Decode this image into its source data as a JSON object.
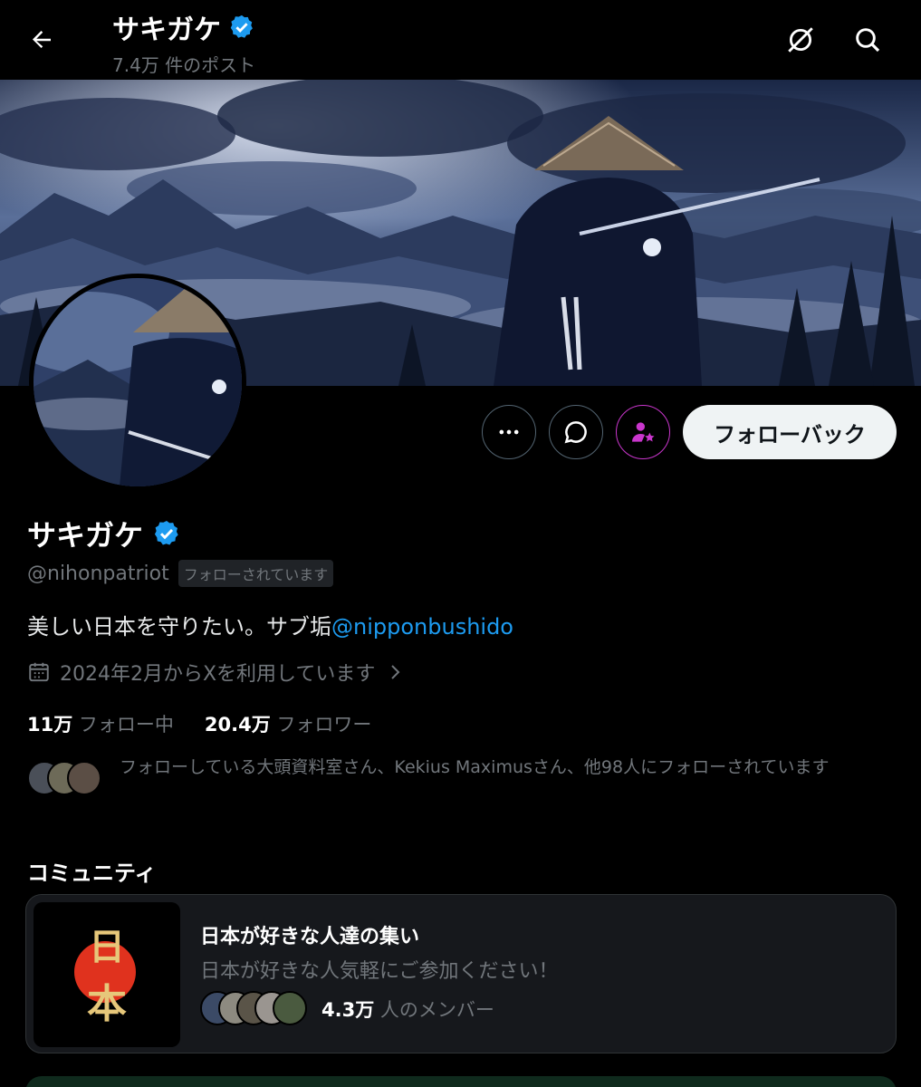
{
  "header": {
    "title": "サキガケ",
    "post_count": "7.4万 件のポスト"
  },
  "profile": {
    "name": "サキガケ",
    "handle": "@nihonpatriot",
    "follows_you_badge": "フォローされています",
    "bio_text": "美しい日本を守りたい。サブ垢",
    "bio_mention": "@nipponbushido",
    "joined": "2024年2月からXを利用しています",
    "following_count": "11万",
    "following_label": "フォロー中",
    "followers_count": "20.4万",
    "followers_label": "フォロワー",
    "followed_by_text": "フォローしている大頭資料室さん、Kekius Maximusさん、他98人にフォローされています"
  },
  "actions": {
    "follow_back_label": "フォローバック"
  },
  "community": {
    "section_title": "コミュニティ",
    "name": "日本が好きな人達の集い",
    "description": "日本が好きな人気軽にご参加ください！",
    "member_count": "4.3万",
    "member_label": "人のメンバー",
    "thumb_text_top": "日",
    "thumb_text_bottom": "本"
  },
  "colors": {
    "accent_blue": "#1d9bf0",
    "subscribe_purple": "#c936cc",
    "muted": "#71767b"
  },
  "icons": {
    "back": "arrow-left-icon",
    "grok": "grok-slash-icon",
    "search": "search-icon",
    "more": "more-dots-icon",
    "message": "message-bubble-icon",
    "subscribe": "person-star-icon",
    "verified": "verified-badge-icon",
    "calendar": "calendar-icon",
    "chevron": "chevron-right-icon"
  }
}
